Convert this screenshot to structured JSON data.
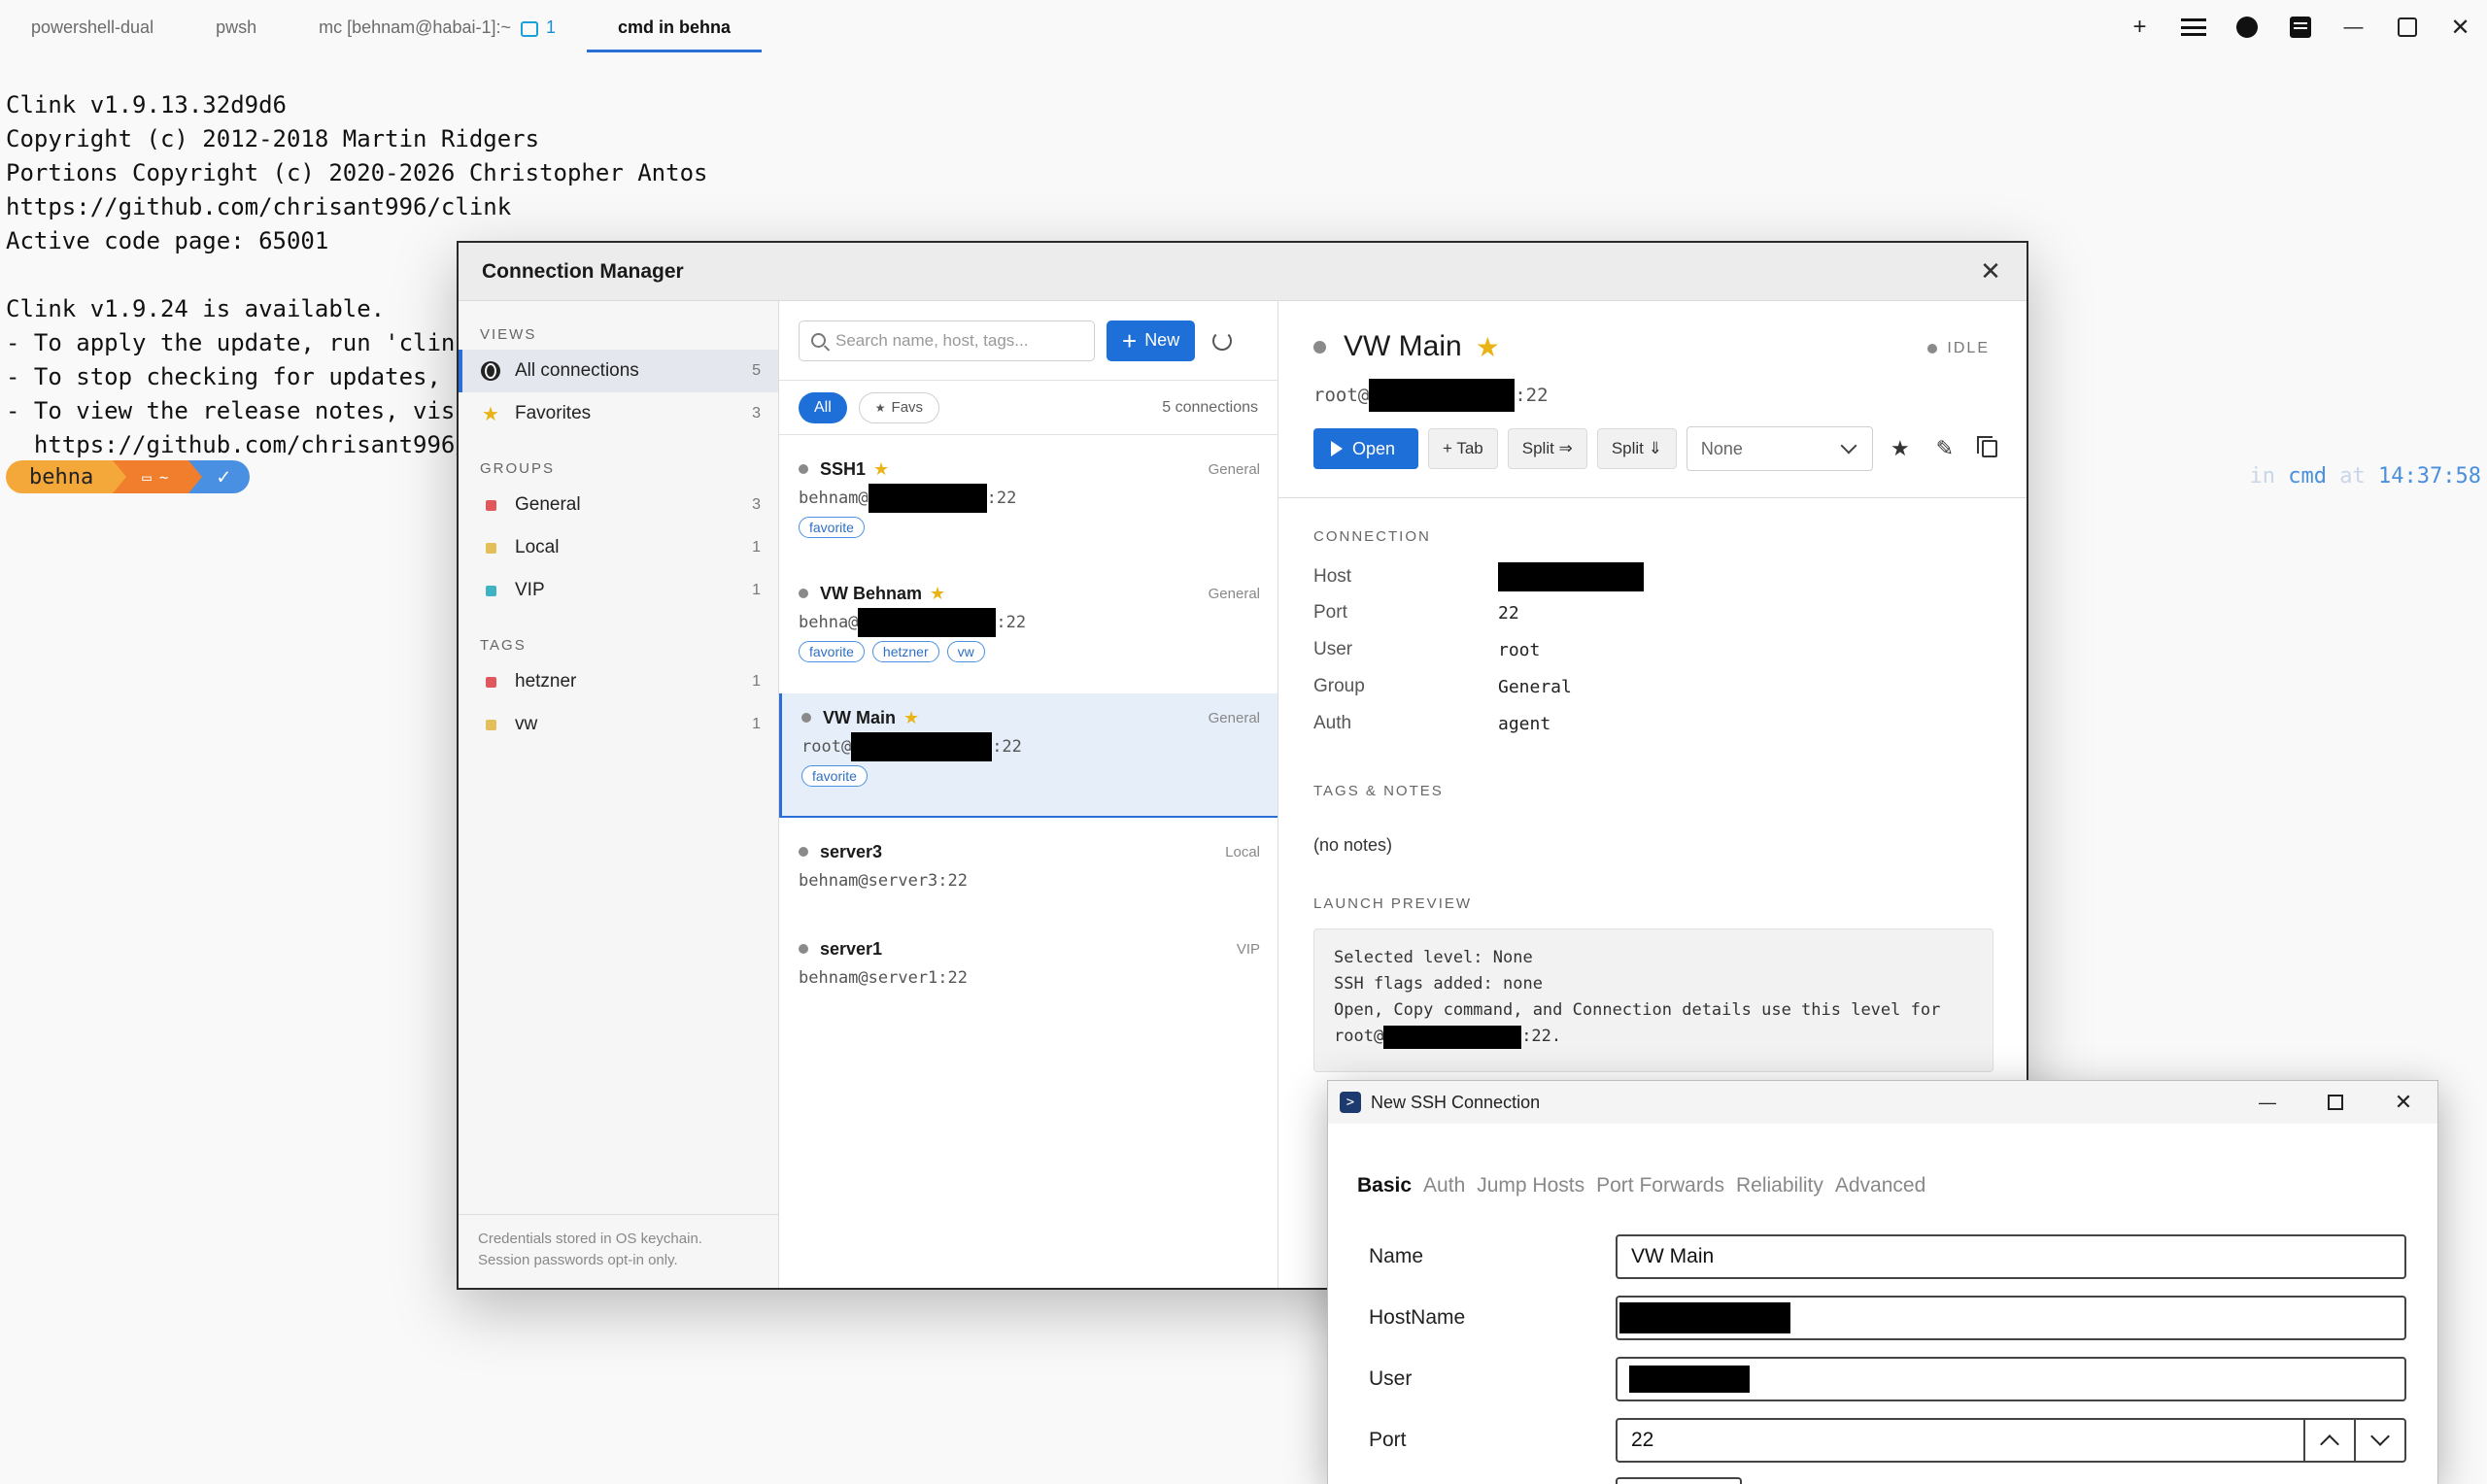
{
  "tabs": [
    {
      "label": "powershell-dual"
    },
    {
      "label": "pwsh"
    },
    {
      "label": "mc [behnam@habai-1]:~",
      "count": "1"
    },
    {
      "label": "cmd in behna"
    }
  ],
  "window_controls": {
    "add": "+",
    "minimize": "—",
    "close": "✕"
  },
  "terminal": {
    "lines": [
      "Clink v1.9.13.32d9d6",
      "Copyright (c) 2012-2018 Martin Ridgers",
      "Portions Copyright (c) 2020-2026 Christopher Antos",
      "https://github.com/chrisant996/clink",
      "Active code page: 65001",
      "",
      "Clink v1.9.24 is available.",
      "- To apply the update, run 'clink",
      "- To stop checking for updates, r",
      "- To view the release notes, visi",
      "  https://github.com/chrisant996/"
    ],
    "prompt": {
      "user": "behna",
      "dir": "~",
      "status": "✓"
    },
    "right_prompt": {
      "in": "in",
      "shell": "cmd",
      "at": "at",
      "time": "14:37:58"
    }
  },
  "manager": {
    "title": "Connection Manager",
    "views_label": "VIEWS",
    "views": [
      {
        "label": "All connections",
        "count": "5",
        "icon": "globe-icon"
      },
      {
        "label": "Favorites",
        "count": "3",
        "icon": "star-icon"
      }
    ],
    "groups_label": "GROUPS",
    "groups": [
      {
        "label": "General",
        "count": "3",
        "color": "#e0585c"
      },
      {
        "label": "Local",
        "count": "1",
        "color": "#e3bf5a"
      },
      {
        "label": "VIP",
        "count": "1",
        "color": "#3fb3c2"
      }
    ],
    "tags_label": "TAGS",
    "tags": [
      {
        "label": "hetzner",
        "count": "1",
        "color": "#e0585c"
      },
      {
        "label": "vw",
        "count": "1",
        "color": "#e3bf5a"
      }
    ],
    "footer_line1": "Credentials stored in OS keychain.",
    "footer_line2": "Session passwords opt-in only.",
    "search_placeholder": "Search name, host, tags...",
    "new_label": "New",
    "filter_all": "All",
    "filter_favs": "Favs",
    "connection_count": "5 connections",
    "connections": [
      {
        "name": "SSH1",
        "group": "General",
        "user": "behnam@",
        "port": ":22",
        "tags": [
          "favorite"
        ],
        "favorite": true
      },
      {
        "name": "VW Behnam",
        "group": "General",
        "user": "behna@",
        "port": ":22",
        "tags": [
          "favorite",
          "hetzner",
          "vw"
        ],
        "favorite": true
      },
      {
        "name": "VW Main",
        "group": "General",
        "user": "root@",
        "port": ":22",
        "tags": [
          "favorite"
        ],
        "favorite": true
      },
      {
        "name": "server3",
        "group": "Local",
        "addr": "behnam@server3:22"
      },
      {
        "name": "server1",
        "group": "VIP",
        "addr": "behnam@server1:22"
      }
    ],
    "detail": {
      "name": "VW Main",
      "status": "IDLE",
      "user": "root@",
      "port": ":22",
      "open_label": "Open",
      "tab_label": "+ Tab",
      "split_h_label": "Split ⇒",
      "split_v_label": "Split ⇓",
      "level_selected": "None",
      "connection_label": "CONNECTION",
      "fields": [
        {
          "k": "Host",
          "v": ""
        },
        {
          "k": "Port",
          "v": "22"
        },
        {
          "k": "User",
          "v": "root"
        },
        {
          "k": "Group",
          "v": "General"
        },
        {
          "k": "Auth",
          "v": "agent"
        }
      ],
      "tags_notes_label": "TAGS & NOTES",
      "notes": "(no notes)",
      "launch_preview_label": "LAUNCH PREVIEW",
      "preview_line1": "Selected level: None",
      "preview_line2": "SSH flags added: none",
      "preview_line3": "Open, Copy command, and Connection details use this level for",
      "preview_line4_user": "root@",
      "preview_line4_end": ":22."
    }
  },
  "ssh_dialog": {
    "title": "New SSH Connection",
    "tabs": [
      "Basic",
      "Auth",
      "Jump Hosts",
      "Port Forwards",
      "Reliability",
      "Advanced"
    ],
    "fields": [
      {
        "label": "Name",
        "value": "VW Main"
      },
      {
        "label": "HostName",
        "value": ""
      },
      {
        "label": "User",
        "value": ""
      },
      {
        "label": "Port",
        "value": "22"
      }
    ]
  }
}
